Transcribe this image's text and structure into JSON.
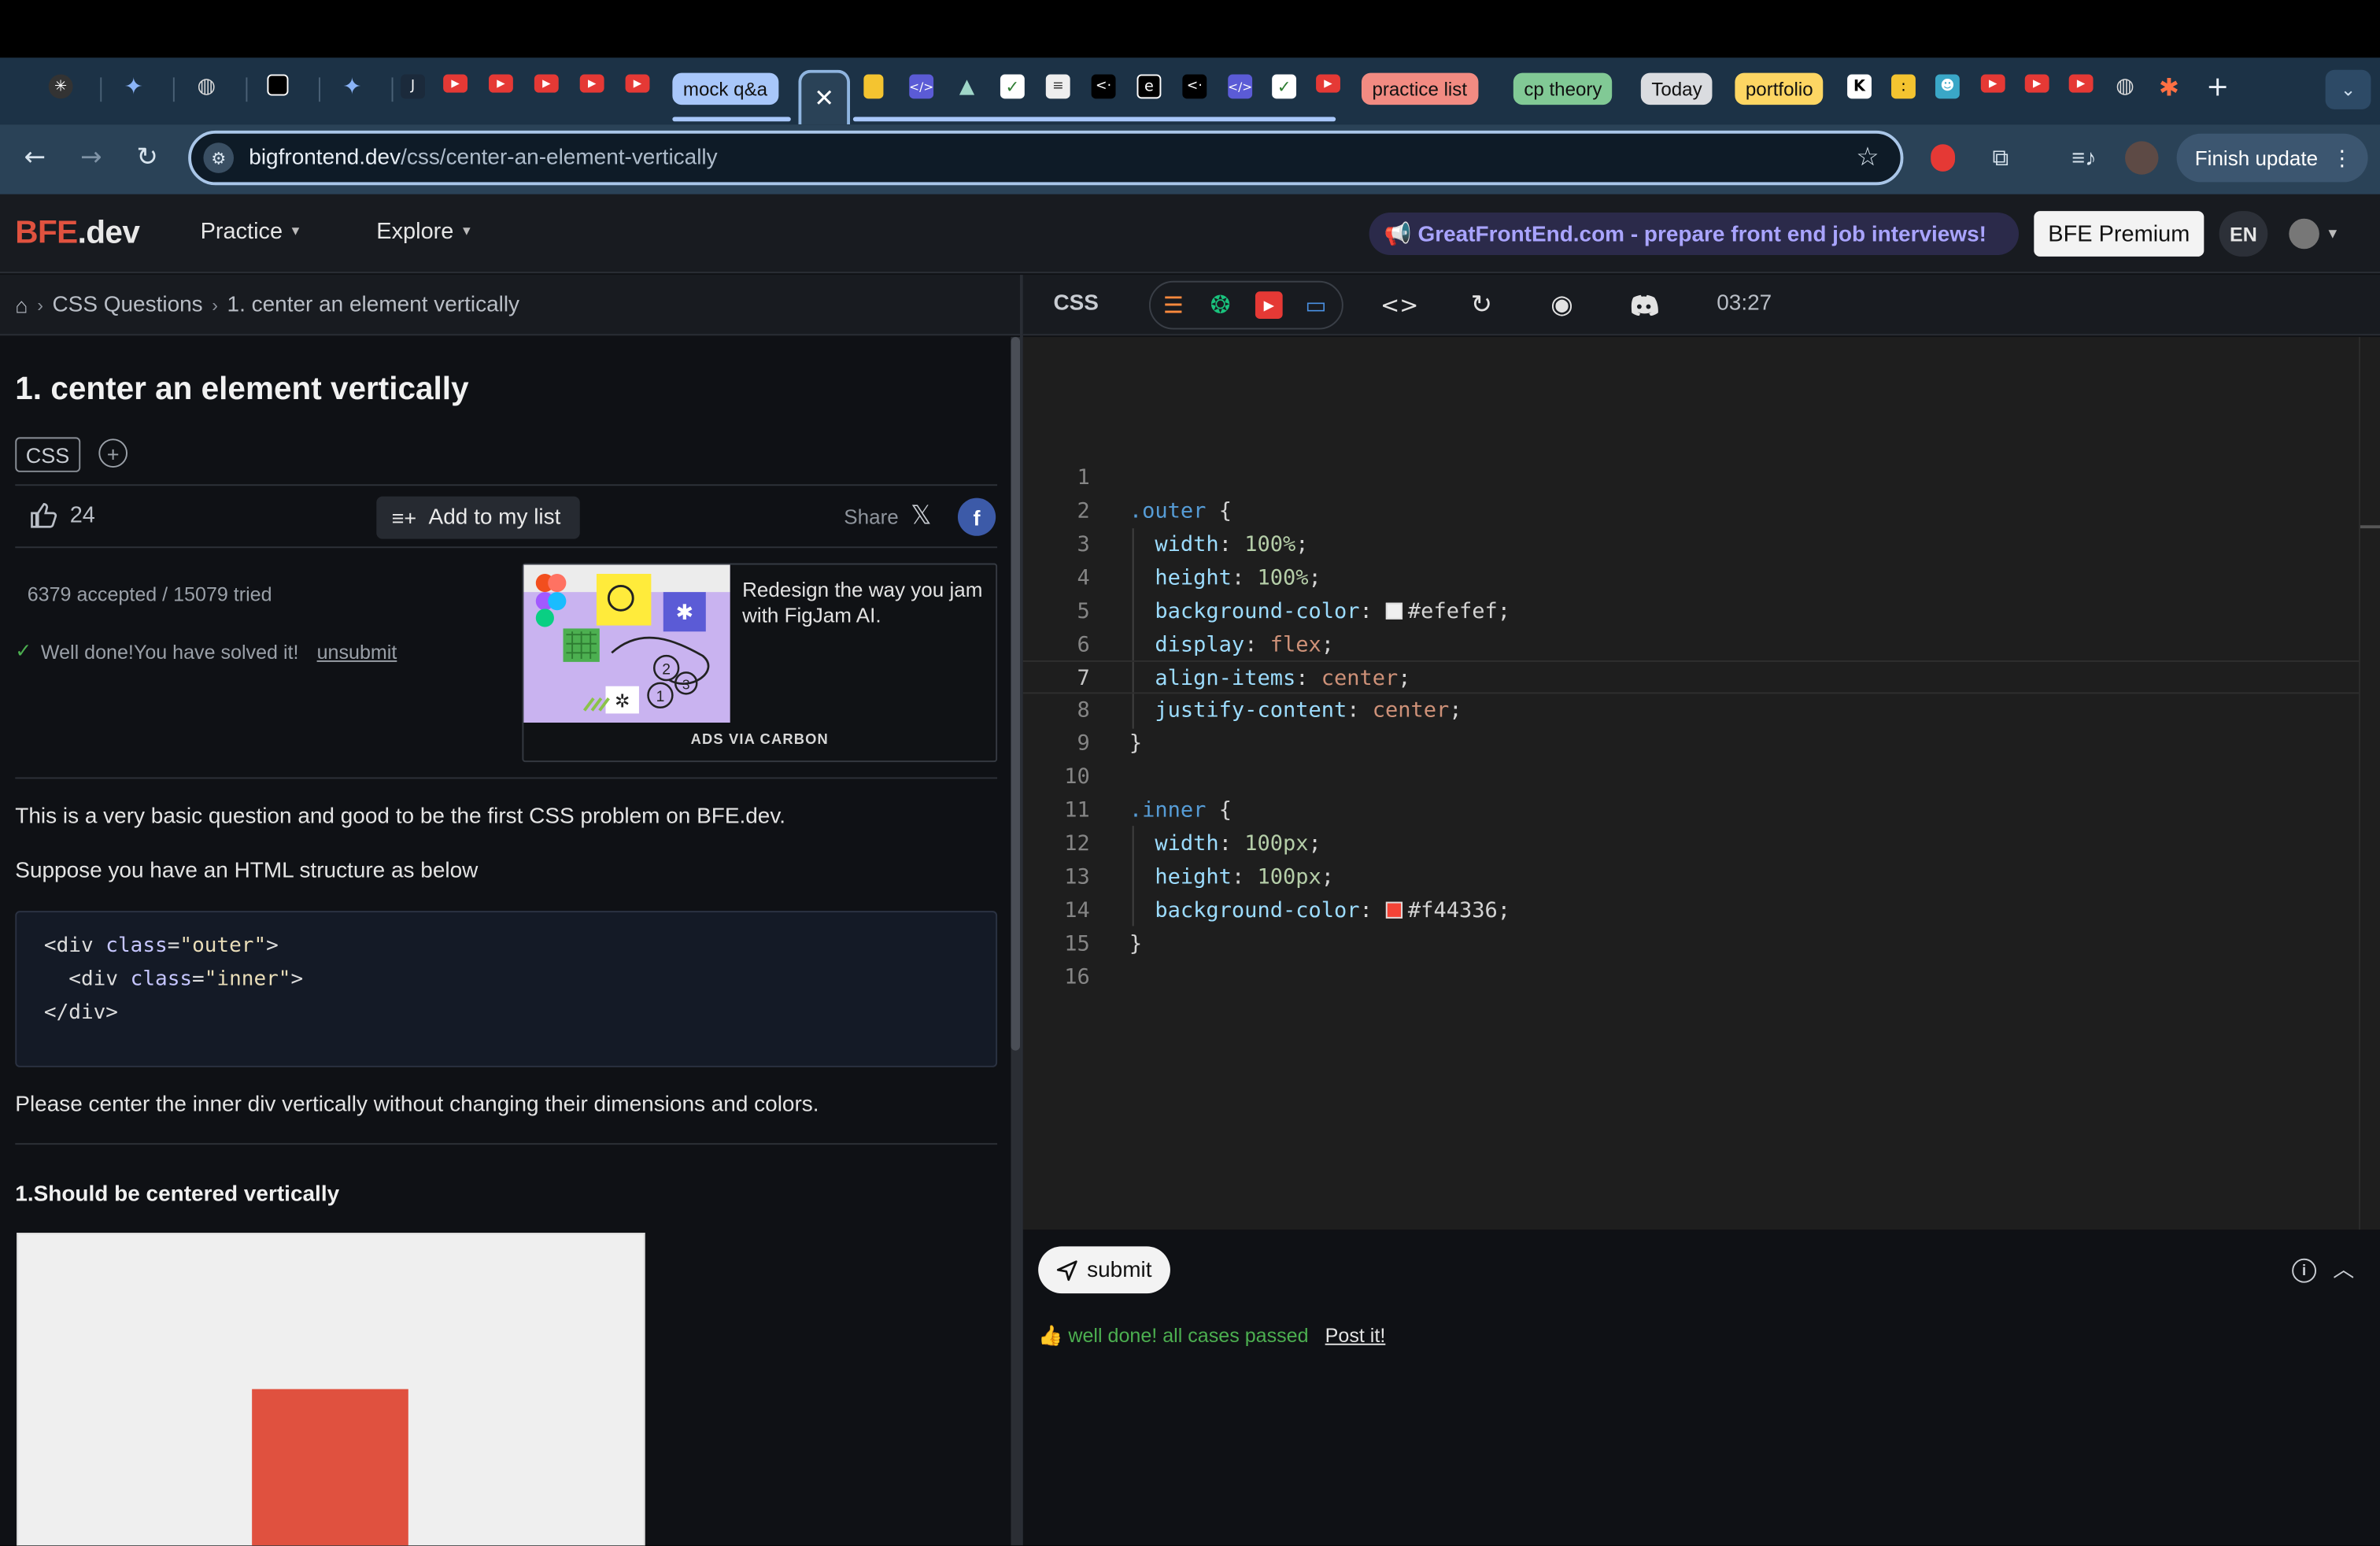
{
  "browser": {
    "tab_groups": [
      {
        "label": "mock q&a",
        "color": "#a8c7fa"
      },
      {
        "label": "practice list",
        "color": "#f28b82"
      },
      {
        "label": "cp theory",
        "color": "#81c995"
      },
      {
        "label": "Today",
        "color": "#dadce0"
      },
      {
        "label": "portfolio",
        "color": "#fdd663"
      }
    ],
    "active_tab_icon": "close-icon",
    "url_domain": "bigfrontend.dev",
    "url_path": "/css/center-an-element-vertically",
    "finish_update_label": "Finish update",
    "accent": "#a8c7fa"
  },
  "site": {
    "logo_bfe": "BFE",
    "logo_dev": ".dev",
    "nav": [
      "Practice",
      "Explore"
    ],
    "banner": "📢 GreatFrontEnd.com - prepare front end job interviews!",
    "premium_label": "BFE Premium",
    "lang": "EN",
    "brand_color": "#e0523f"
  },
  "breadcrumb": {
    "items": [
      "CSS Questions",
      "1. center an element vertically"
    ]
  },
  "question": {
    "title": "1. center an element vertically",
    "tag": "CSS",
    "likes": "24",
    "add_to_list": "Add to my list",
    "share": "Share",
    "stats": "6379 accepted / 15079 tried",
    "solved_text": "Well done!You have solved it!",
    "unsubmit": "unsubmit",
    "ad_text": "Redesign the way you jam with FigJam AI.",
    "ad_via": "ADS VIA CARBON",
    "intro": "This is a very basic question and good to be the first CSS problem on BFE.dev.",
    "structure_lead": "Suppose you have an HTML structure as below",
    "html_lines": [
      {
        "indent": "",
        "open": "<div ",
        "attr": "class",
        "eq": "=",
        "val": "\"outer\"",
        "close": ">"
      },
      {
        "indent": "  ",
        "open": "<div ",
        "attr": "class",
        "eq": "=",
        "val": "\"inner\"",
        "close": ">"
      },
      {
        "indent": "",
        "open": "</div>",
        "attr": "",
        "eq": "",
        "val": "",
        "close": ""
      }
    ],
    "instruction": "Please center the inner div vertically without changing their dimensions and colors.",
    "case_title": "1.Should be centered vertically",
    "preview_outer_color": "#efefef",
    "preview_inner_color": "#e0513f"
  },
  "editor": {
    "lang_label": "CSS",
    "timer": "03:27",
    "active_line": 7,
    "lines": [
      "",
      ".outer {",
      "  width: 100%;",
      "  height: 100%;",
      "  background-color: #efefef;",
      "  display: flex;",
      "  align-items: center;",
      "  justify-content: center;",
      "}",
      "",
      ".inner {",
      "  width: 100px;",
      "  height: 100px;",
      "  background-color: #f44336;",
      "}",
      ""
    ]
  },
  "result": {
    "submit_label": "submit",
    "message": "👍 well done! all cases passed",
    "post_it": "Post it!",
    "success_color": "#4caf50"
  }
}
